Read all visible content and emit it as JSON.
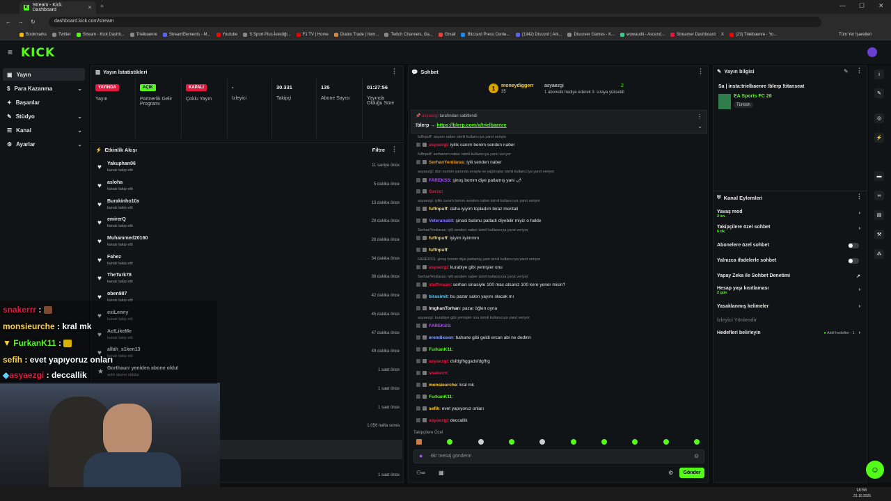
{
  "browser": {
    "tab_title": "Stream - Kick Dashboard",
    "url": "dashboard.kick.com/stream",
    "bookmarks": [
      "Bookmarks",
      "Twitter",
      "Stream - Kick Dashb...",
      "Trielbaenre",
      "StreamElements - M...",
      "Youtube",
      "S Sport Plus-İstediği...",
      "F1 TV | Home",
      "Diablo Trade | Item...",
      "Twitch Channels, Ga...",
      "Gmail",
      "Blizzard Press Cente...",
      "(1342) Discord | Ark...",
      "Discover Games - K...",
      "wowaudit - Ascend...",
      "Streamer Dashboard",
      "X",
      "(23) Trielbaenre - Yo..."
    ],
    "all_bookmarks": "Tüm Yer İşaretleri"
  },
  "app": {
    "logo": "KICK"
  },
  "sidebar": {
    "items": [
      {
        "label": "Yayın"
      },
      {
        "label": "Para Kazanma"
      },
      {
        "label": "Başarılar"
      },
      {
        "label": "Stüdyo"
      },
      {
        "label": "Kanal"
      },
      {
        "label": "Ayarlar"
      }
    ]
  },
  "stats": {
    "title": "Yayın İstatistikleri",
    "cells": [
      {
        "badge": "YAYINDA",
        "label": "Yayın",
        "color": "#e5173f"
      },
      {
        "badge": "AÇIK",
        "label": "Partnerlik Gelir Programı",
        "color": "#53fc18"
      },
      {
        "badge": "KAPALI",
        "label": "Çoklu Yayın",
        "color": "#e5173f"
      },
      {
        "value": "-",
        "label": "İzleyici"
      },
      {
        "value": "30.331",
        "label": "Takipçi"
      },
      {
        "value": "135",
        "label": "Abone Sayısı"
      },
      {
        "value": "01:27:56",
        "label": "Yayında Olduğu Süre"
      }
    ]
  },
  "events": {
    "title": "Etkinlik Akışı",
    "filter": "Filtre",
    "rows": [
      {
        "name": "Yakuphan06",
        "sub": "kanalı takip etti",
        "time": "11 saniye önce"
      },
      {
        "name": "asloha",
        "sub": "kanalı takip etti",
        "time": "5 dakika önce"
      },
      {
        "name": "Burakinho10x",
        "sub": "kanalı takip etti",
        "time": "13 dakika önce"
      },
      {
        "name": "emirerQ",
        "sub": "kanalı takip etti",
        "time": "28 dakika önce"
      },
      {
        "name": "Muhammed20160",
        "sub": "kanalı takip etti",
        "time": "28 dakika önce"
      },
      {
        "name": "Fahez",
        "sub": "kanalı takip etti",
        "time": "34 dakika önce"
      },
      {
        "name": "TheTurk78",
        "sub": "kanalı takip etti",
        "time": "38 dakika önce"
      },
      {
        "name": "oben987",
        "sub": "kanalı takip etti",
        "time": "42 dakika önce"
      },
      {
        "name": "exiLenny",
        "sub": "kanalı takip etti",
        "time": "45 dakika önce"
      },
      {
        "name": "ActLikeMe",
        "sub": "kanalı takip etti",
        "time": "47 dakika önce"
      },
      {
        "name": "allah_s1ken13",
        "sub": "kanalı takip etti",
        "time": "49 dakika önce"
      },
      {
        "name": "Gorthaurr yeniden abone oldu!",
        "sub": "aylık abone oldular",
        "time": "1 saat önce"
      },
      {
        "name": "",
        "sub": "",
        "time": "1 saat önce"
      },
      {
        "name": "",
        "sub": "",
        "time": "1 saat önce"
      },
      {
        "name": "",
        "sub": "",
        "time": "1.056 hafta sonra"
      },
      {
        "name": "",
        "sub": "",
        "time": "1 saat önce"
      }
    ]
  },
  "overlay": [
    {
      "name": "snakerrr",
      "text": ":"
    },
    {
      "name": "monsieurche",
      "text": ": kral mk"
    },
    {
      "name": "FurkanK11",
      "text": ":"
    },
    {
      "name": "sefih",
      "text": ": evet yapıyoruz onları"
    },
    {
      "name": "asyaezgi",
      "text": ": deccallik"
    }
  ],
  "chat": {
    "title": "Sohbet",
    "top_gifter": {
      "name": "moneydiggerr",
      "count": "35",
      "with": "asyaezgi",
      "with_count": "2",
      "msg": "1 abonelik hediye ederek 3. sıraya yükseldi"
    },
    "pinned": {
      "by": "asyaezgi",
      "by_suffix": "tarafından sabitlendi",
      "text": "!blerp →",
      "link": "https://blerp.com/x/trielbaenre"
    },
    "messages": [
      {
        "reply": "fuffnpuff: asyam naber isimli kullanıcıya yanıt veriyor",
        "user": "asyaezgi",
        "color": "#e5173f",
        "text": "iyilik canım benim senden naber"
      },
      {
        "reply": "fuffnpuff: serhanım naber isimli kullanıcıya yanıt veriyor",
        "user": "SerhanYenilaras",
        "color": "#e39b28",
        "text": "iyili senden naber"
      },
      {
        "reply": "asyaezgi: dün nurinin yanında sırayla ve yapmışlar isimli kullanıcıya yanıt veriyor",
        "user": "FAREKSS",
        "color": "#b04cff",
        "text": "şinoş bomm diye patlamış yani 🌶"
      },
      {
        "reply": "",
        "user": "Garzo",
        "color": "#e5173f",
        "text": ""
      },
      {
        "reply": "asyaezgi: iyilik canım benim senden naber isimli kullanıcıya yanıt veriyor",
        "user": "fuffnpuff",
        "color": "#ffd23f",
        "text": "daha iyiyim topladım biraz mentali"
      },
      {
        "reply": "",
        "user": "Veteranabit",
        "color": "#8a7cff",
        "text": "şinasi balonu patladı diyebilir miyiz o halde"
      },
      {
        "reply": "SerhanYenilaras: iyili senden naber isimli kullanıcıya yanıt veriyor",
        "user": "fuffnpuff",
        "color": "#ffd23f",
        "text": "iyiyim iiyimmm"
      },
      {
        "reply": "",
        "user": "fuffnpuff",
        "color": "#ffd23f",
        "text": ""
      },
      {
        "reply": "FAREKSS: şinoş bomm diye patlamış yani isimli kullanıcıya yanıt veriyor",
        "user": "asyaezgi",
        "color": "#e5173f",
        "text": "kurabiye gibi yemişler onu"
      },
      {
        "reply": "SerhanYenilaras: iyili senden naber isimli kullanıcıya yanıt veriyor",
        "user": "stuffmaan",
        "color": "#e5173f",
        "text": "serhan sinasiyle 100 mac atsaniz 100 kere yener misin?"
      },
      {
        "reply": "",
        "user": "birasimit",
        "color": "#5bd2ff",
        "text": "bu pazar salon yayını olacak mı"
      },
      {
        "reply": "",
        "user": "ImghanTorhan",
        "color": "#f0f0f0",
        "text": "pazar öğlen oyna"
      },
      {
        "reply": "asyaezgi: kurabiye gibi yemişler onu isimli kullanıcıya yanıt veriyor",
        "user": "FAREKSS",
        "color": "#b04cff",
        "text": ""
      },
      {
        "reply": "",
        "user": "erendixonn",
        "color": "#8fa8ff",
        "text": "bahane gibi geldi ercan abi ne dedinn"
      },
      {
        "reply": "",
        "user": "FurkanK11",
        "color": "#53fc18",
        "text": ""
      },
      {
        "reply": "",
        "user": "asyaezgi",
        "color": "#e5173f",
        "text": "dsfdgfhggadsfdgfhg"
      },
      {
        "reply": "",
        "user": "snakerrr",
        "color": "#e5173f",
        "text": ""
      },
      {
        "reply": "",
        "user": "monsieurche",
        "color": "#ffd23f",
        "text": "kral mk"
      },
      {
        "reply": "",
        "user": "FurkanK11",
        "color": "#53fc18",
        "text": ""
      },
      {
        "reply": "",
        "user": "sefih",
        "color": "#ffd23f",
        "text": "evet yapıyoruz onları"
      },
      {
        "reply": "",
        "user": "asyaezgi",
        "color": "#e5173f",
        "text": "deccallik"
      }
    ],
    "mode": "Takipçilere Özel",
    "input_placeholder": "Bir mesaj gönderin",
    "send_label": "Gönder"
  },
  "info": {
    "title": "Yayın bilgisi",
    "stream_title": "Sa | insta:trielbaenre !blerp !titanseat",
    "category": "EA Sports FC 26",
    "language": "Türkish"
  },
  "actions": {
    "title": "Kanal Eylemleri",
    "items": [
      {
        "label": "Yavaş mod",
        "sub": "2 sn."
      },
      {
        "label": "Takipçilere özel sohbet",
        "sub": "6 dk."
      },
      {
        "label": "Abonelere özel sohbet",
        "sub": ""
      },
      {
        "label": "Yalnızca ifadelerle sohbet",
        "sub": ""
      },
      {
        "label": "Yapay Zeka ile Sohbet Denetimi",
        "sub": ""
      },
      {
        "label": "Hesap yaşı kısıtlaması",
        "sub": "2 gün"
      },
      {
        "label": "Yasaklanmış kelimeler",
        "sub": ""
      },
      {
        "label": "İzleyici Yönlendir",
        "sub": ""
      },
      {
        "label": "Hedefleri belirleyin",
        "sub": ""
      }
    ],
    "goals_status": "Aktif hedefler - 1"
  },
  "taskbar": {
    "time": "18:58",
    "date": "31.10.2025"
  }
}
